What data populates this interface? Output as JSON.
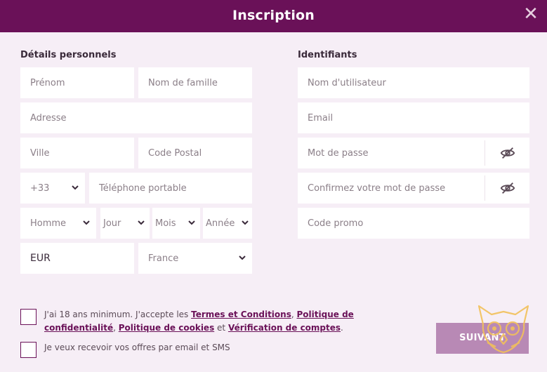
{
  "header": {
    "title": "Inscription",
    "close_label": "✕"
  },
  "personal": {
    "title": "Détails personnels",
    "first_name": "Prénom",
    "last_name": "Nom de famille",
    "address": "Adresse",
    "city": "Ville",
    "postal_code": "Code Postal",
    "phone_prefix": "+33",
    "phone": "Téléphone portable",
    "gender": "Homme",
    "day": "Jour",
    "month": "Mois",
    "year": "Année",
    "currency": "EUR",
    "country": "France"
  },
  "credentials": {
    "title": "Identifiants",
    "username": "Nom d'utilisateur",
    "email": "Email",
    "password": "Mot de passe",
    "confirm_password": "Confirmez votre mot de passe",
    "promo": "Code promo"
  },
  "consent": {
    "age_prefix": "J'ai 18 ans minimum. J'accepte les ",
    "terms": "Termes et Conditions",
    "sep1": ", ",
    "privacy": "Politique de confidentialité",
    "sep2": ", ",
    "cookies": "Politique de cookies",
    "and": " et ",
    "verification": "Vérification de comptes",
    "end": ".",
    "marketing": "Je veux recevoir vos offres par email et SMS"
  },
  "actions": {
    "next": "SUIVANT"
  },
  "colors": {
    "brand": "#6a1158",
    "background": "#f6eef6",
    "button": "#b889b5",
    "accent_gold": "#f2c15a"
  },
  "icons": {
    "close": "close-icon",
    "chevron": "chevron-down-icon",
    "password_toggle": "eye-off-icon",
    "logo": "owl-logo-icon"
  }
}
